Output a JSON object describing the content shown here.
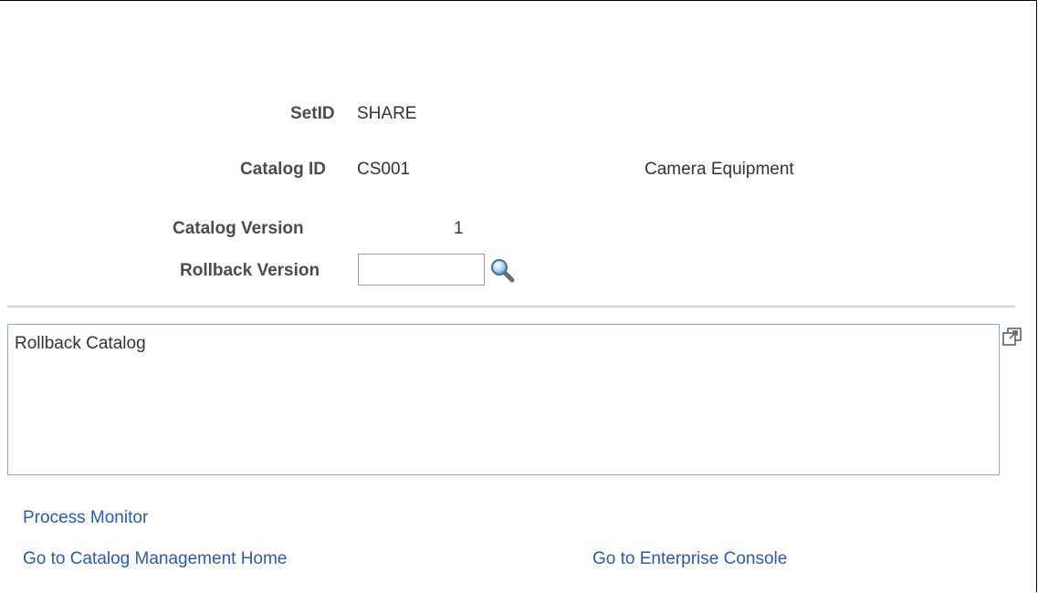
{
  "fields": {
    "setid": {
      "label": "SetID",
      "value": "SHARE"
    },
    "catalog_id": {
      "label": "Catalog ID",
      "value": "CS001",
      "description": "Camera Equipment"
    },
    "catalog_version": {
      "label": "Catalog Version",
      "value": "1"
    },
    "rollback_version": {
      "label": "Rollback Version",
      "value": "",
      "placeholder": ""
    }
  },
  "comments": {
    "value": "Rollback Catalog"
  },
  "links": {
    "process_monitor": "Process Monitor",
    "catalog_home": "Go to Catalog Management Home",
    "enterprise_console": "Go to Enterprise Console"
  },
  "icons": {
    "lookup": "search-icon",
    "expand": "expand-icon"
  },
  "colors": {
    "link": "#2a5aa8",
    "label": "#4b4b4b",
    "textarea_border": "#8aa8d2",
    "divider": "#cfcfcf"
  }
}
